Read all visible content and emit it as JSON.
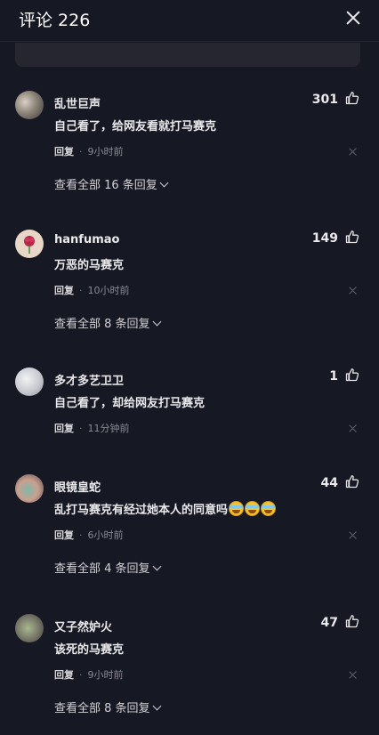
{
  "header": {
    "title": "评论 226"
  },
  "comments": [
    {
      "username": "乱世巨声",
      "likes": "301",
      "text": "自己看了，给网友看就打马赛克",
      "reply_label": "回复",
      "separator": "·",
      "time": "9小时前",
      "view_all": "查看全部 16 条回复"
    },
    {
      "username": "hanfumao",
      "likes": "149",
      "text": "万恶的马赛克",
      "reply_label": "回复",
      "separator": "·",
      "time": "10小时前",
      "view_all": "查看全部 8 条回复"
    },
    {
      "username": "多才多艺卫卫",
      "likes": "1",
      "text": "自己看了，却给网友打马赛克",
      "reply_label": "回复",
      "separator": "·",
      "time": "11分钟前"
    },
    {
      "username": "眼镜皇蛇",
      "likes": "44",
      "text": "乱打马赛克有经过她本人的同意吗",
      "reply_label": "回复",
      "separator": "·",
      "time": "6小时前",
      "view_all": "查看全部 4 条回复"
    },
    {
      "username": "又子然妒火",
      "likes": "47",
      "text": "该死的马赛克",
      "reply_label": "回复",
      "separator": "·",
      "time": "9小时前",
      "view_all": "查看全部 8 条回复"
    }
  ],
  "icons": {
    "close": "close-icon",
    "like": "thumb-up-icon",
    "delete": "close-small-icon",
    "expand": "chevron-down-icon",
    "emoji": "crying-laughing-emoji"
  },
  "colors": {
    "background": "#161823",
    "input_bg": "#25262f",
    "text": "#e9e9eb",
    "muted": "#8a8b94"
  }
}
